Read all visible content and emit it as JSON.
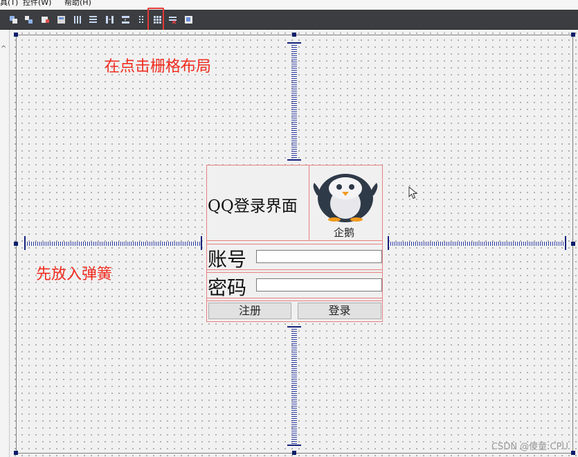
{
  "menubar": {
    "items": [
      {
        "label": "具(T)"
      },
      {
        "label": "控件(W)"
      },
      {
        "label": "帮助(H)"
      }
    ]
  },
  "toolbar": {
    "icons": [
      "edit-widgets-icon",
      "edit-signals-icon",
      "edit-buddies-icon",
      "edit-tab-order-icon",
      "layout-horizontal-icon",
      "layout-vertical-icon",
      "layout-horizontal-splitter-icon",
      "layout-vertical-splitter-icon",
      "layout-form-icon",
      "layout-grid-icon",
      "break-layout-icon",
      "adjust-size-icon"
    ],
    "highlighted_icon": "layout-grid-icon"
  },
  "annotations": {
    "top": "在点击栅格布局",
    "left": "先放入弹簧"
  },
  "form": {
    "title": "QQ登录界面",
    "penguin_label": "企鹅",
    "account_label": "账号",
    "account_value": "",
    "password_label": "密码",
    "password_value": "",
    "register_button": "注册",
    "login_button": "登录"
  },
  "watermark": "CSDN @傻童:CPU",
  "colors": {
    "annotation": "#f02b1f",
    "layout_border": "#e88080",
    "spring": "#2a3aa0",
    "toolbar_bg": "#3b3d40"
  }
}
